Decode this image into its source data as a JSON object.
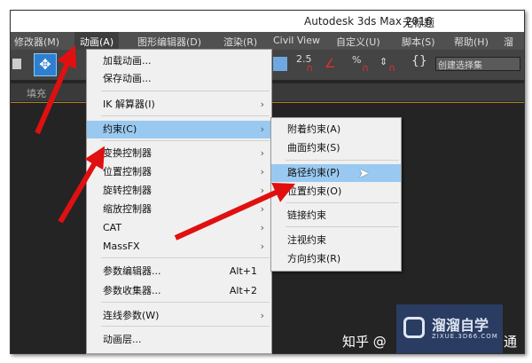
{
  "title": {
    "app": "Autodesk 3ds Max 2016",
    "doc": "无标题"
  },
  "menubar": [
    "修改器(M)",
    "动画(A)",
    "图形编辑器(D)",
    "渲染(R)",
    "Civil View",
    "自定义(U)",
    "脚本(S)",
    "帮助(H)",
    "溜"
  ],
  "toolbar": {
    "snap_value": "2.5",
    "percent": "%",
    "selection_set": "创建选择集"
  },
  "ribbon": {
    "tab": "填充"
  },
  "animation_menu": [
    {
      "label": "加载动画..."
    },
    {
      "label": "保存动画..."
    },
    {
      "label": "IK 解算器(I)",
      "submenu": true
    },
    {
      "label": "约束(C)",
      "submenu": true,
      "highlighted": true
    },
    {
      "label": "变换控制器",
      "submenu": true
    },
    {
      "label": "位置控制器",
      "submenu": true
    },
    {
      "label": "旋转控制器",
      "submenu": true
    },
    {
      "label": "缩放控制器",
      "submenu": true
    },
    {
      "label": "CAT",
      "submenu": true
    },
    {
      "label": "MassFX",
      "submenu": true
    },
    {
      "label": "参数编辑器...",
      "shortcut": "Alt+1"
    },
    {
      "label": "参数收集器...",
      "shortcut": "Alt+2"
    },
    {
      "label": "连线参数(W)",
      "submenu": true
    },
    {
      "label": "动画层..."
    }
  ],
  "constraint_menu": [
    {
      "label": "附着约束(A)"
    },
    {
      "label": "曲面约束(S)"
    },
    {
      "label": "路径约束(P)",
      "highlighted": true
    },
    {
      "label": "位置约束(O)"
    },
    {
      "label": "链接约束"
    },
    {
      "label": "注视约束"
    },
    {
      "label": "方向约束(R)"
    }
  ],
  "watermark": {
    "text": "知乎 @",
    "suffix": "通",
    "logo_name": "溜溜自学",
    "logo_url": "ZIXUE.3D66.COM"
  },
  "colors": {
    "highlight": "#99c9f0",
    "arrow": "#e01010"
  }
}
